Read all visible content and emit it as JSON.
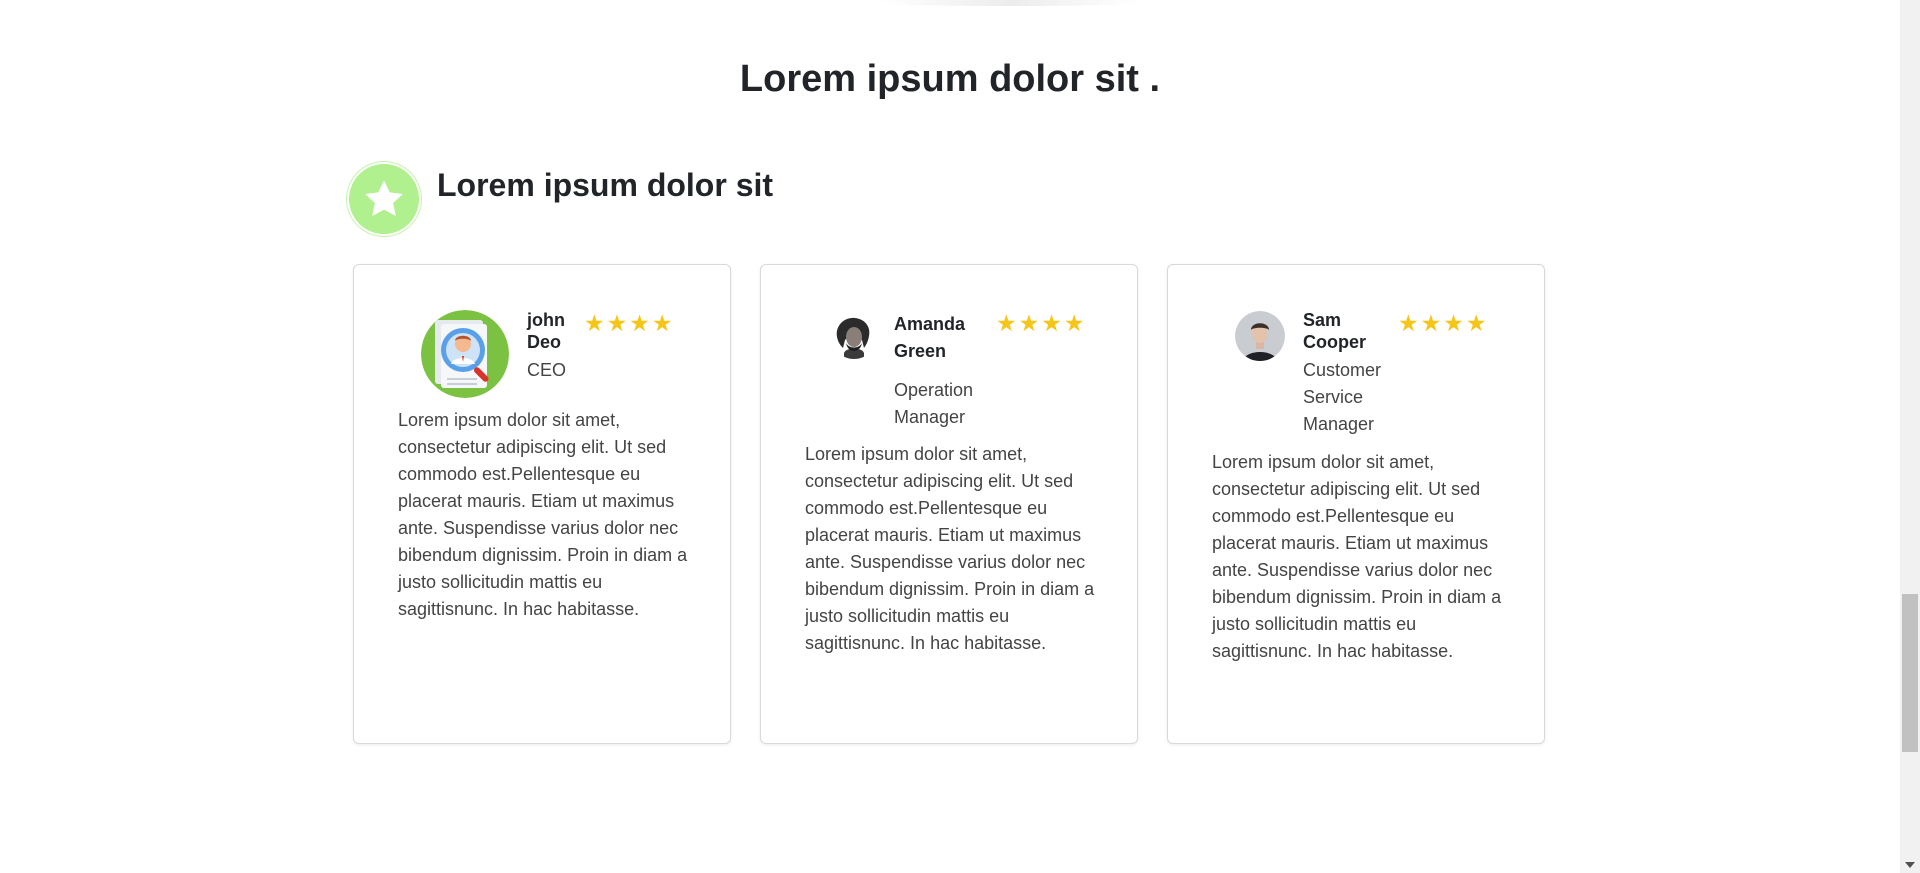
{
  "page": {
    "title": "Lorem ipsum dolor sit ."
  },
  "section": {
    "title": "Lorem ipsum dolor sit",
    "icon": "star-badge-icon"
  },
  "colors": {
    "star": "#f5c518",
    "badge": "#b1f08f"
  },
  "testimonials": [
    {
      "name": "john Deo",
      "role": "CEO",
      "rating": 4,
      "avatar_icon": "job-seeker-avatar-icon",
      "text": "Lorem ipsum dolor sit amet, consectetur adipiscing elit. Ut sed commodo est.Pellentesque eu placerat mauris. Etiam ut maximus ante. Suspendisse varius dolor nec bibendum dignissim. Proin in diam a justo sollicitudin mattis eu sagittisnunc. In hac habitasse."
    },
    {
      "name": "Amanda Green",
      "role": "Operation Manager",
      "rating": 4,
      "avatar_icon": "portrait-avatar-icon",
      "text": "Lorem ipsum dolor sit amet, consectetur adipiscing elit. Ut sed commodo est.Pellentesque eu placerat mauris. Etiam ut maximus ante. Suspendisse varius dolor nec bibendum dignissim. Proin in diam a justo sollicitudin mattis eu sagittisnunc. In hac habitasse."
    },
    {
      "name": "Sam Cooper",
      "role": "Customer Service Manager",
      "rating": 4,
      "avatar_icon": "portrait-avatar-icon",
      "text": "Lorem ipsum dolor sit amet, consectetur adipiscing elit. Ut sed commodo est.Pellentesque eu placerat mauris. Etiam ut maximus ante. Suspendisse varius dolor nec bibendum dignissim. Proin in diam a justo sollicitudin mattis eu sagittisnunc. In hac habitasse."
    }
  ]
}
